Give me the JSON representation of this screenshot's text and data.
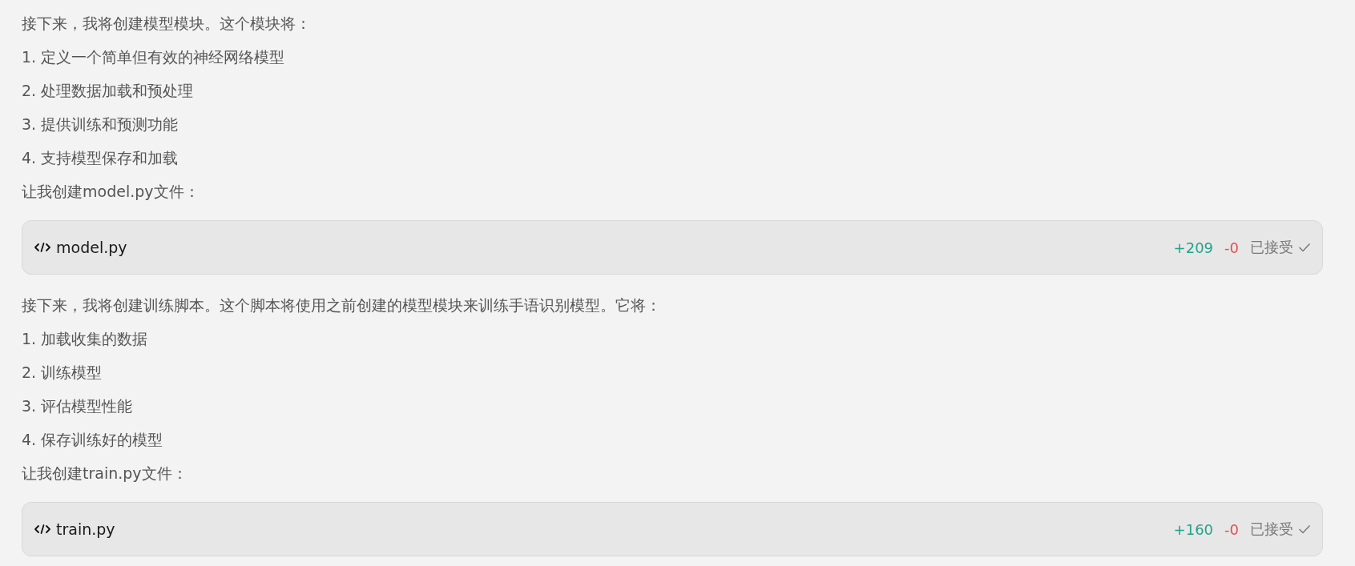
{
  "blocks": [
    {
      "kind": "text",
      "text": "接下来，我将创建模型模块。这个模块将："
    },
    {
      "kind": "text",
      "text": "1. 定义一个简单但有效的神经网络模型"
    },
    {
      "kind": "text",
      "text": "2. 处理数据加载和预处理"
    },
    {
      "kind": "text",
      "text": "3. 提供训练和预测功能"
    },
    {
      "kind": "text",
      "text": "4. 支持模型保存和加载"
    },
    {
      "kind": "text",
      "text": "让我创建model.py文件："
    },
    {
      "kind": "file",
      "name": "model.py",
      "added": "+209",
      "removed": "-0",
      "status": "已接受"
    },
    {
      "kind": "text",
      "text": "接下来，我将创建训练脚本。这个脚本将使用之前创建的模型模块来训练手语识别模型。它将："
    },
    {
      "kind": "text",
      "text": "1. 加载收集的数据"
    },
    {
      "kind": "text",
      "text": "2. 训练模型"
    },
    {
      "kind": "text",
      "text": "3. 评估模型性能"
    },
    {
      "kind": "text",
      "text": "4. 保存训练好的模型"
    },
    {
      "kind": "text",
      "text": "让我创建train.py文件："
    },
    {
      "kind": "file",
      "name": "train.py",
      "added": "+160",
      "removed": "-0",
      "status": "已接受"
    }
  ]
}
